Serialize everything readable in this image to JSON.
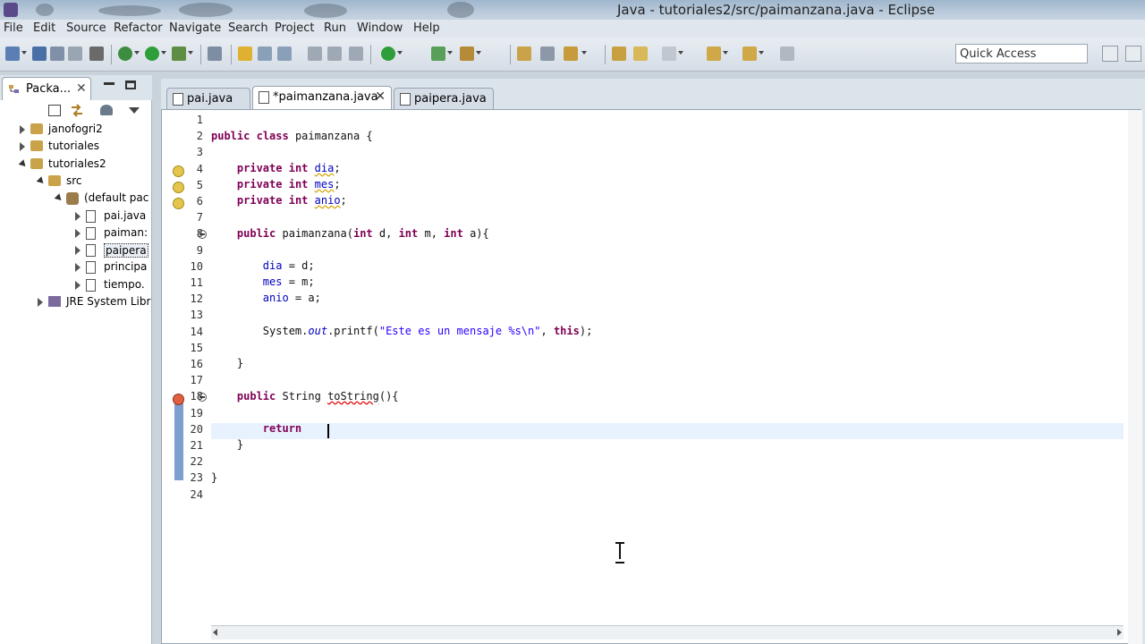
{
  "window": {
    "title": "Java - tutoriales2/src/paimanzana.java - Eclipse"
  },
  "menu": [
    "File",
    "Edit",
    "Source",
    "Refactor",
    "Navigate",
    "Search",
    "Project",
    "Run",
    "Window",
    "Help"
  ],
  "toolbar": {
    "quick_access": "Quick Access"
  },
  "package_explorer": {
    "tab_label": "Packa...",
    "tree": [
      {
        "label": "janofogri2",
        "level": 0,
        "state": "closed",
        "icon": "project-icon"
      },
      {
        "label": "tutoriales",
        "level": 0,
        "state": "closed",
        "icon": "project-icon"
      },
      {
        "label": "tutoriales2",
        "level": 0,
        "state": "open",
        "icon": "project-icon"
      },
      {
        "label": "src",
        "level": 1,
        "state": "open",
        "icon": "source-folder-icon"
      },
      {
        "label": "(default pac",
        "level": 2,
        "state": "open",
        "icon": "package-icon"
      },
      {
        "label": "pai.java",
        "level": 3,
        "state": "closed",
        "icon": "java-file-icon"
      },
      {
        "label": "paiman:",
        "level": 3,
        "state": "closed",
        "icon": "java-file-icon"
      },
      {
        "label": "paipera",
        "level": 3,
        "state": "closed",
        "icon": "java-file-icon",
        "selected": true
      },
      {
        "label": "principa",
        "level": 3,
        "state": "closed",
        "icon": "java-file-icon"
      },
      {
        "label": "tiempo.",
        "level": 3,
        "state": "closed",
        "icon": "java-file-icon"
      },
      {
        "label": "JRE System Libr",
        "level": 1,
        "state": "closed",
        "icon": "library-icon"
      }
    ]
  },
  "editor": {
    "tabs": [
      {
        "label": "pai.java",
        "active": false
      },
      {
        "label": "*paimanzana.java",
        "active": true
      },
      {
        "label": "paipera.java",
        "active": false
      }
    ],
    "lines": [
      "1",
      "2",
      "3",
      "4",
      "5",
      "6",
      "7",
      "8",
      "9",
      "10",
      "11",
      "12",
      "13",
      "14",
      "15",
      "16",
      "17",
      "18",
      "19",
      "20",
      "21",
      "22",
      "23",
      "24"
    ],
    "code": {
      "l2_kw1": "public",
      "l2_kw2": "class",
      "l2_rest": " paimanzana {",
      "private_kw": "private",
      "int_kw": "int",
      "f_dia": "dia",
      "f_mes": "mes",
      "f_anio": "anio",
      "l8_kw": "public",
      "l8_name": "paimanzana",
      "l8_p1": "(",
      "l8_kw2": "int",
      "l8_p2": " d, ",
      "l8_kw3": "int",
      "l8_p3": " m, ",
      "l8_kw4": "int",
      "l8_p4": " a){",
      "l10_rest": " = d;",
      "l11_rest": " = m;",
      "l12_rest": " = a;",
      "l14_a": "System.",
      "l14_out": "out",
      "l14_b": ".printf(",
      "l14_str": "\"Este es un mensaje %s\\n\"",
      "l14_c": ", ",
      "l14_this": "this",
      "l14_d": ");",
      "l16": "}",
      "l18_kw": "public",
      "l18_type": " String ",
      "l18_method": "toString",
      "l18_rest": "(){",
      "l20_kw": "return",
      "l21": "}",
      "l23": "}"
    }
  }
}
